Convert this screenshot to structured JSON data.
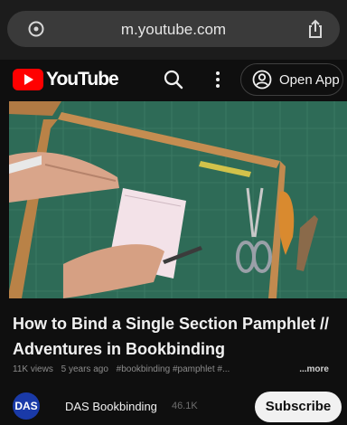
{
  "browser": {
    "url": "m.youtube.com",
    "icons": {
      "tab_switch": "tab-switch-icon",
      "share": "share-icon"
    }
  },
  "header": {
    "logo_text": "YouTube",
    "open_app_label": "Open App",
    "icons": {
      "search": "search-icon",
      "more": "more-vert-icon",
      "account": "account-circle-icon"
    },
    "brand_color": "#ff0000"
  },
  "video": {
    "title": "How to Bind a Single Section Pamphlet // Adventures in Bookbinding",
    "views": "11K views",
    "age": "5 years ago",
    "tags": "#bookbinding #pamphlet #...",
    "more_label": "...more"
  },
  "channel": {
    "avatar_text": "DAS",
    "name": "DAS Bookbinding",
    "subscribers": "46.1K",
    "subscribe_label": "Subscribe"
  }
}
